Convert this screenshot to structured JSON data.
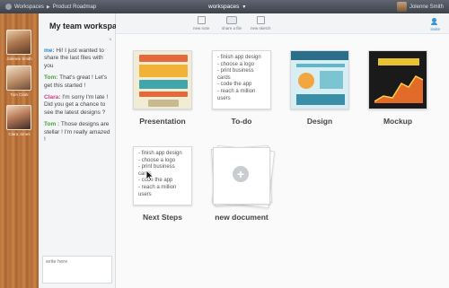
{
  "topbar": {
    "breadcrumb": [
      "Workspaces",
      "Product Roadmap"
    ],
    "workspace_menu": "workspaces",
    "user_name": "Jolenne Smith"
  },
  "members": [
    {
      "name": "Jolenne Smith"
    },
    {
      "name": "Tom Clark"
    },
    {
      "name": "Clara Jones"
    }
  ],
  "chat": {
    "title": "My team workspace",
    "close": "×",
    "messages": [
      {
        "author": "me:",
        "author_key": "me",
        "text": "Hi! I just wanted to share the last files with you"
      },
      {
        "author": "Tom:",
        "author_key": "tom",
        "text": "That's great ! Let's get this started !"
      },
      {
        "author": "Clara:",
        "author_key": "clara",
        "text": "I'm sorry I'm late ! Did you get a chance to see the latest designs ?"
      },
      {
        "author": "Tom :",
        "author_key": "tom",
        "text": "Those designs are stellar ! I'm really amazed !"
      }
    ],
    "input_placeholder": "write here"
  },
  "toolbar": {
    "new_note": "new note",
    "share_file": "share a file",
    "new_sketch": "new sketch",
    "invite": "invite"
  },
  "documents": {
    "presentation": {
      "label": "Presentation"
    },
    "todo": {
      "label": "To-do",
      "items": [
        "- finish app design",
        "- choose a logo",
        "- print business",
        "cards",
        "- code the app",
        "- reach a million",
        "users"
      ]
    },
    "design": {
      "label": "Design"
    },
    "mockup": {
      "label": "Mockup"
    },
    "next_steps": {
      "label": "Next Steps",
      "items": [
        "- finish app design",
        "- choose a logo",
        "- print business",
        "cards",
        "- code the app",
        "- reach a million",
        "users"
      ]
    },
    "new_document": {
      "label": "new document"
    }
  },
  "colors": {
    "accent": "#2f86c9",
    "wood": "#b9733e",
    "topbar": "#4a5058"
  }
}
